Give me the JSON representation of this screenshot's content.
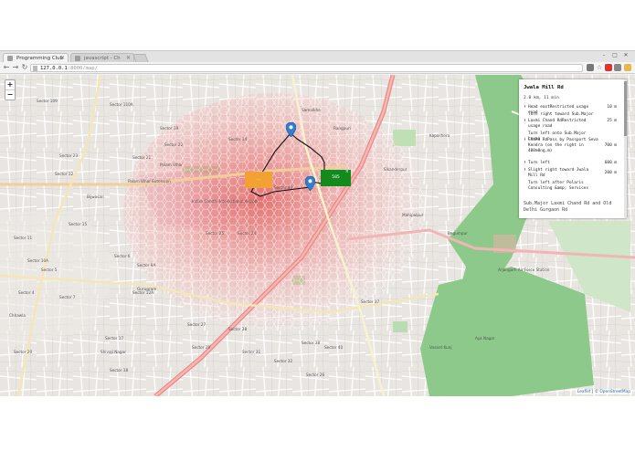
{
  "browser": {
    "tabs": [
      {
        "title": "Programming Club"
      },
      {
        "title": "javascript - Ch"
      }
    ],
    "address": {
      "host": "127.0.0.1",
      "path": ":8000/map/"
    }
  },
  "map": {
    "zoom_in_label": "+",
    "zoom_out_label": "−",
    "place_labels": [
      "Sector 110A",
      "Sector 109",
      "Sector 23",
      "Sector 22",
      "Sector 21",
      "Sector 19",
      "Sector 12",
      "Sector 6",
      "Sector 7",
      "Sector 5",
      "Sector 10A",
      "Sector 9A",
      "Sector 11",
      "Sector 4",
      "Sector 12A",
      "Sector 15",
      "Sector 17",
      "Sector 18",
      "Sector 20",
      "Sector 27",
      "Sector 28",
      "Sector 29",
      "Sector 31",
      "Sector 32",
      "Sector 44",
      "Sector 14",
      "Sector 38",
      "Sector 40",
      "Sector 37",
      "Gurugram",
      "Palam Vihar",
      "Palam Vihar Extension",
      "Shivaji Nagar",
      "Sikanderpur",
      "Mahipalpur",
      "Rangpuri",
      "Kapashera",
      "Samalkha",
      "Vasant Kunj",
      "Arjangarh Air Force Station",
      "Indira Gandhi International Airport",
      "Chhawla",
      "Bijwasan",
      "Begumpur",
      "Aya Nagar",
      "Sector 25",
      "Sector 24",
      "Sector 26"
    ],
    "orange_label": "...",
    "green_label": "585",
    "green_close": "×"
  },
  "directions": {
    "title": "Jwala Mill Rd",
    "summary": "2.8 km, 11 min",
    "steps": [
      {
        "icon": "head-icon",
        "text": "Head eastRestricted usage road",
        "distance": "10 m"
      },
      {
        "icon": "none",
        "text": "Turn right toward Sub.Major",
        "distance": ""
      },
      {
        "icon": "turn-icon",
        "text": "Laxmi Chand RdRestricted usage road",
        "distance": "25 m"
      },
      {
        "icon": "none",
        "text": "Turn left onto Sub.Major Laxmi",
        "distance": ""
      },
      {
        "icon": "turn-icon",
        "text": "Chand RdPass by Passport Seva Kendra (on the right in 400m0ng,m)",
        "distance": "700 m"
      },
      {
        "icon": "turn-icon",
        "text": "Turn left",
        "distance": "600 m"
      },
      {
        "icon": "turn-icon",
        "text": "Slight right toward Jwala Mill Rd",
        "distance": "200 m"
      },
      {
        "icon": "none",
        "text": "Turn left after Polaris Consulting &amp; Services",
        "distance": ""
      }
    ],
    "footer": "Sub.Major Laxmi Chand Rd and Old Delhi Gurgaon Rd"
  },
  "attribution": {
    "leaflet": "Leaflet",
    "sep": "|",
    "osm": "© OpenStreetMap"
  },
  "colors": {
    "route_line": "#111111",
    "marker": "#2f7fd0",
    "heat": "#e64a4a",
    "forest": "#69b36b"
  }
}
